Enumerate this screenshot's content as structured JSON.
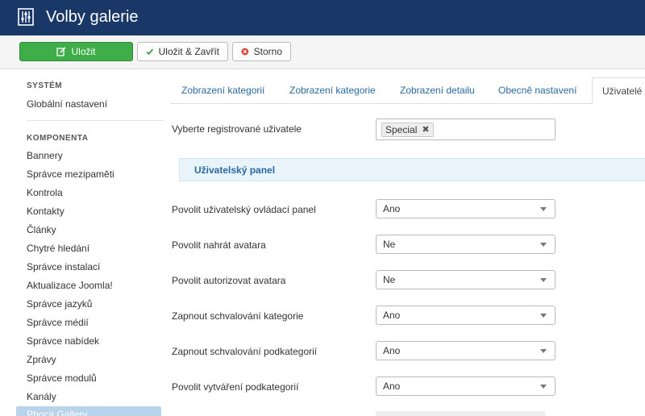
{
  "header": {
    "title": "Volby galerie",
    "icon": "options-sliders-icon"
  },
  "toolbar": {
    "save_label": "Uložit",
    "save_close_label": "Uložit & Zavřít",
    "cancel_label": "Storno",
    "colors": {
      "save": "#3fae49",
      "cancel_icon": "#d9443a",
      "check": "#3a9b3f"
    }
  },
  "sidebar": {
    "system_heading": "SYSTÉM",
    "global_settings": "Globální nastavení",
    "component_heading": "KOMPONENTA",
    "items": [
      "Bannery",
      "Správce mezipaměti",
      "Kontrola",
      "Kontakty",
      "Články",
      "Chytré hledání",
      "Správce instalací",
      "Aktualizace Joomla!",
      "Správce jazyků",
      "Správce médií",
      "Správce nabídek",
      "Zprávy",
      "Správce modulů",
      "Kanály"
    ],
    "active_item": "Phoca Gallery"
  },
  "tabs": [
    "Zobrazení kategorií",
    "Zobrazení kategorie",
    "Zobrazení detailu",
    "Obecně nastavení",
    "Uživatelé"
  ],
  "form": {
    "users_label": "Vyberte registrované uživatele",
    "users_selected": "Special",
    "panel_title": "Uživatelský panel",
    "fields": [
      {
        "label": "Povolit uživatelský ovládací panel",
        "value": "Ano"
      },
      {
        "label": "Povolit nahrát avatara",
        "value": "Ne"
      },
      {
        "label": "Povolit autorizovat avatara",
        "value": "Ne"
      },
      {
        "label": "Zapnout schvalování kategorie",
        "value": "Ano"
      },
      {
        "label": "Zapnout schvalování podkategorií",
        "value": "Ano"
      },
      {
        "label": "Povolit vytváření podkategorií",
        "value": "Ano"
      }
    ]
  }
}
